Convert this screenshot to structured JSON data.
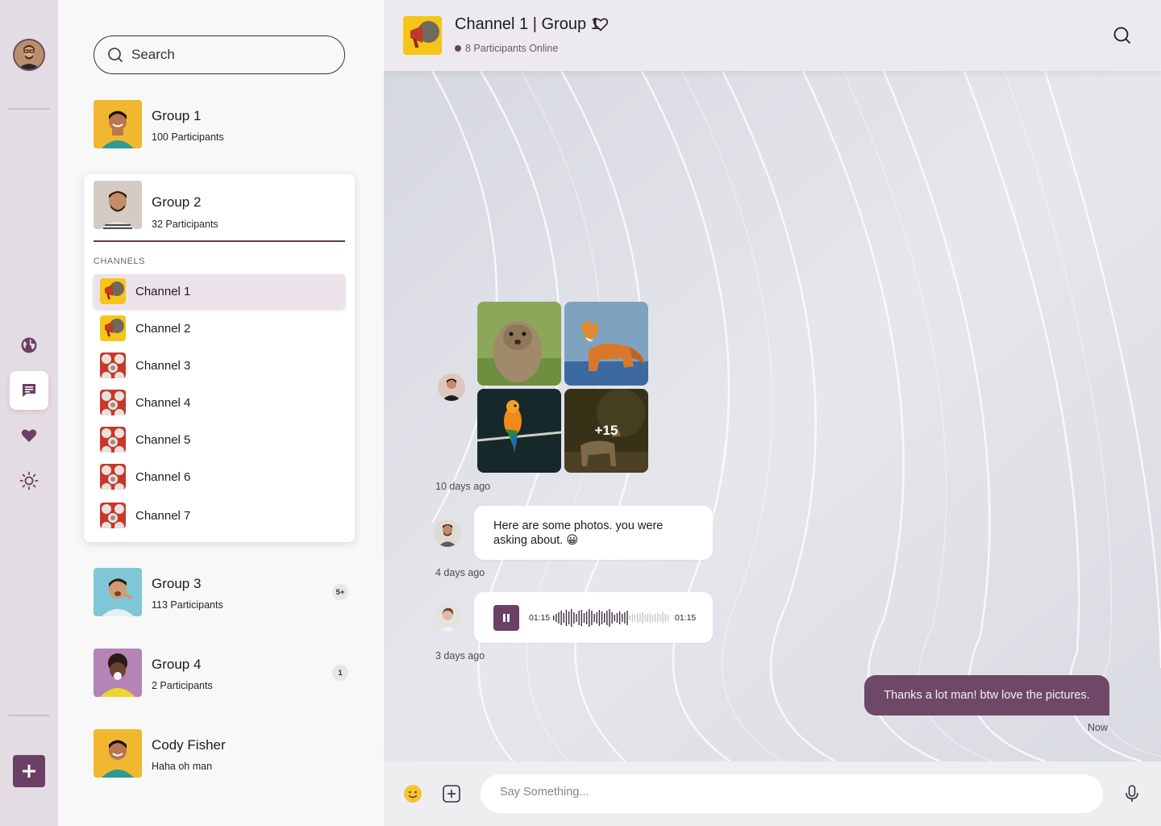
{
  "search": {
    "placeholder": "Search"
  },
  "groups": [
    {
      "name": "Group 1",
      "subtitle": "100 Participants"
    },
    {
      "name": "Group 2",
      "subtitle": "32 Participants"
    },
    {
      "name": "Group 3",
      "subtitle": "113 Participants",
      "badge": "5+"
    },
    {
      "name": "Group 4",
      "subtitle": "2 Participants",
      "badge": "1"
    },
    {
      "name": "Cody Fisher",
      "subtitle": "Haha oh man"
    }
  ],
  "channels_label": "CHANNELS",
  "channels": [
    {
      "name": "Channel 1",
      "active": true
    },
    {
      "name": "Channel 2"
    },
    {
      "name": "Channel 3"
    },
    {
      "name": "Channel 4"
    },
    {
      "name": "Channel 5"
    },
    {
      "name": "Channel 6"
    },
    {
      "name": "Channel 7"
    }
  ],
  "chat": {
    "title": "Channel 1 | Group 1",
    "online": "8 Participants Online",
    "messages": {
      "photos_more": "+15",
      "photos_time": "10 days ago",
      "text": "Here are some photos. you were asking about. 😀",
      "text_time": "4 days ago",
      "voice_elapsed": "01:15",
      "voice_total": "01:15",
      "voice_time": "3 days ago",
      "mine": "Thanks a lot man! btw love the pictures.",
      "mine_time": "Now"
    },
    "composer_placeholder": "Say Something..."
  },
  "colors": {
    "accent": "#6b3f66",
    "rail": "#e4dce3"
  }
}
